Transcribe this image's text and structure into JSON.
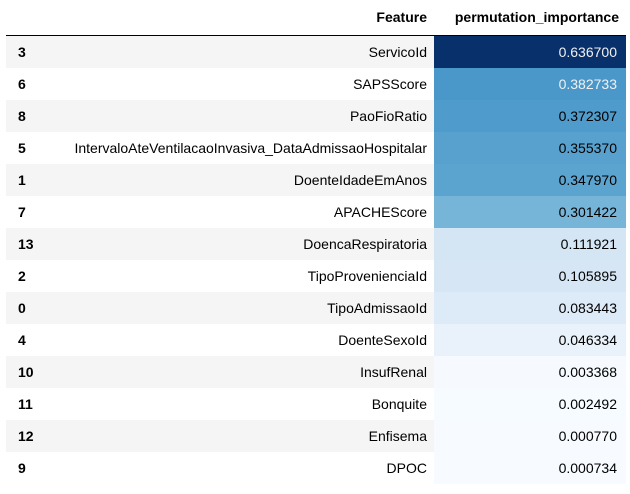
{
  "table": {
    "index_header": "",
    "columns": [
      "Feature",
      "permutation_importance"
    ],
    "colormap": {
      "name": "Blues",
      "stops": [
        "#f7fbff",
        "#deebf7",
        "#c6dbef",
        "#9ecae1",
        "#6baed6",
        "#4292c6",
        "#2171b5",
        "#08519c",
        "#08306b"
      ],
      "min": 0.000734,
      "max": 0.6367,
      "dark_text_color": "#000000",
      "light_text_color": "#f1f1f1"
    },
    "rows": [
      {
        "index": "3",
        "feature": "ServicoId",
        "value": "0.636700"
      },
      {
        "index": "6",
        "feature": "SAPSScore",
        "value": "0.382733"
      },
      {
        "index": "8",
        "feature": "PaoFioRatio",
        "value": "0.372307"
      },
      {
        "index": "5",
        "feature": "IntervaloAteVentilacaoInvasiva_DataAdmissaoHospitalar",
        "value": "0.355370"
      },
      {
        "index": "1",
        "feature": "DoenteIdadeEmAnos",
        "value": "0.347970"
      },
      {
        "index": "7",
        "feature": "APACHEScore",
        "value": "0.301422"
      },
      {
        "index": "13",
        "feature": "DoencaRespiratoria",
        "value": "0.111921"
      },
      {
        "index": "2",
        "feature": "TipoProvenienciaId",
        "value": "0.105895"
      },
      {
        "index": "0",
        "feature": "TipoAdmissaoId",
        "value": "0.083443"
      },
      {
        "index": "4",
        "feature": "DoenteSexoId",
        "value": "0.046334"
      },
      {
        "index": "10",
        "feature": "InsufRenal",
        "value": "0.003368"
      },
      {
        "index": "11",
        "feature": "Bonquite",
        "value": "0.002492"
      },
      {
        "index": "12",
        "feature": "Enfisema",
        "value": "0.000770"
      },
      {
        "index": "9",
        "feature": "DPOC",
        "value": "0.000734"
      }
    ]
  }
}
